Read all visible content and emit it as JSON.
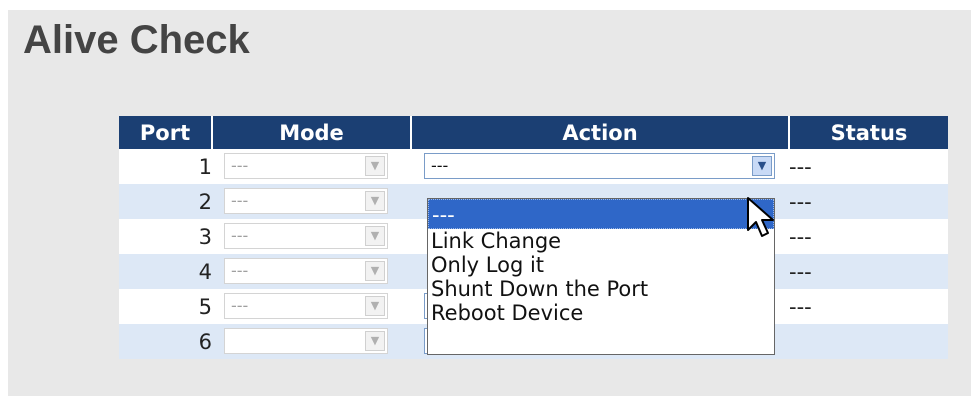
{
  "title": "Alive Check",
  "table": {
    "headers": {
      "port": "Port",
      "mode": "Mode",
      "action": "Action",
      "status": "Status"
    },
    "rows": [
      {
        "port": "1",
        "mode": "---",
        "action": "---",
        "status": "---"
      },
      {
        "port": "2",
        "mode": "---",
        "action": "---",
        "status": "---"
      },
      {
        "port": "3",
        "mode": "---",
        "action": "---",
        "status": "---"
      },
      {
        "port": "4",
        "mode": "---",
        "action": "---",
        "status": "---"
      },
      {
        "port": "5",
        "mode": "---",
        "action": "---",
        "status": "---"
      },
      {
        "port": "6",
        "mode": "",
        "action": "",
        "status": ""
      }
    ]
  },
  "action_dropdown": {
    "options": [
      "---",
      "Link Change",
      "Only Log it",
      "Shunt Down the Port",
      "Reboot Device"
    ],
    "highlighted_index": 0
  },
  "icons": {
    "select_arrow": "chevron-down-icon",
    "cursor": "mouse-pointer-icon"
  },
  "colors": {
    "header_bg": "#1b3f73",
    "row_alt_bg": "#dde8f6",
    "highlight": "#2f67c8",
    "panel_bg": "#e8e8e8"
  }
}
